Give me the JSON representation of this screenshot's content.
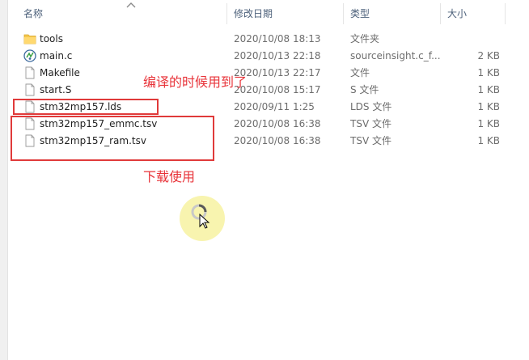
{
  "columns": {
    "name": "名称",
    "date": "修改日期",
    "type": "类型",
    "size": "大小"
  },
  "files": [
    {
      "name": "tools",
      "date": "2020/10/08 18:13",
      "type": "文件夹",
      "size": "",
      "icon": "folder-icon"
    },
    {
      "name": "main.c",
      "date": "2020/10/13 22:18",
      "type": "sourceinsight.c_f...",
      "size": "2 KB",
      "icon": "source-file-icon"
    },
    {
      "name": "Makefile",
      "date": "2020/10/13 22:17",
      "type": "文件",
      "size": "1 KB",
      "icon": "file-icon"
    },
    {
      "name": "start.S",
      "date": "2020/10/08 15:17",
      "type": "S 文件",
      "size": "1 KB",
      "icon": "file-icon"
    },
    {
      "name": "stm32mp157.lds",
      "date": "2020/09/11 1:25",
      "type": "LDS 文件",
      "size": "1 KB",
      "icon": "file-icon"
    },
    {
      "name": "stm32mp157_emmc.tsv",
      "date": "2020/10/08 16:38",
      "type": "TSV 文件",
      "size": "1 KB",
      "icon": "file-icon"
    },
    {
      "name": "stm32mp157_ram.tsv",
      "date": "2020/10/08 16:38",
      "type": "TSV 文件",
      "size": "1 KB",
      "icon": "file-icon"
    }
  ],
  "annotations": {
    "lds_note": "编译的时候用到了",
    "tsv_note": "下载使用"
  },
  "colors": {
    "annotation_red": "#e03a3a",
    "header_text": "#4c607a",
    "cursor_highlight": "#f7f3a6",
    "folder_yellow": "#f5c84c"
  }
}
